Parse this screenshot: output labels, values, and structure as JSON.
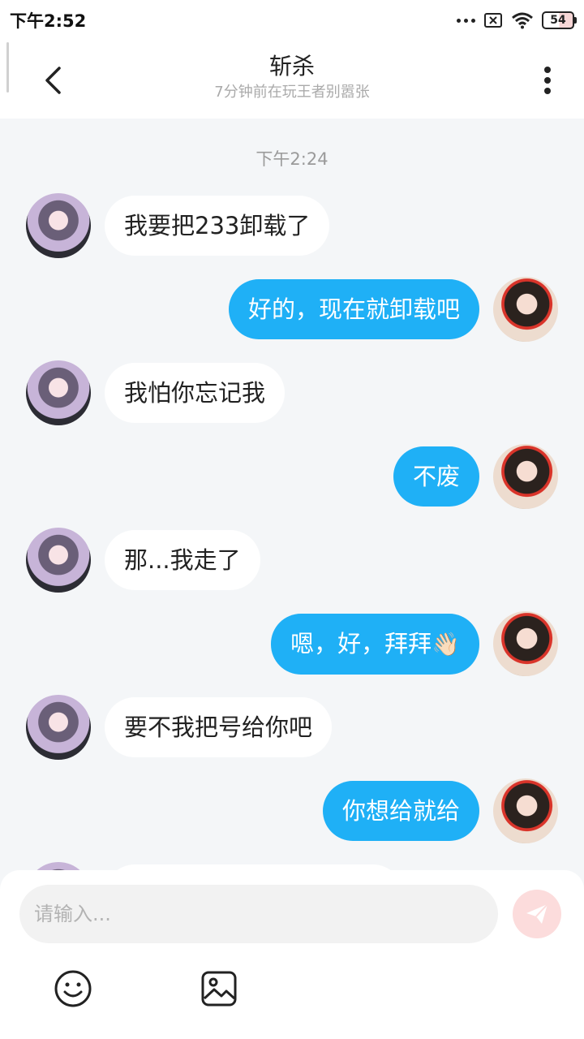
{
  "status_bar": {
    "time": "下午2:52",
    "battery": "54"
  },
  "header": {
    "title": "斩杀",
    "subtitle": "7分钟前在玩王者别嚣张"
  },
  "chat": {
    "timestamp": "下午2:24",
    "messages": [
      {
        "from": "other",
        "text": "我要把233卸载了"
      },
      {
        "from": "me",
        "text": "好的，现在就卸载吧"
      },
      {
        "from": "other",
        "text": "我怕你忘记我"
      },
      {
        "from": "me",
        "text": "不废"
      },
      {
        "from": "other",
        "text": "那...我走了"
      },
      {
        "from": "me",
        "text": "嗯，好，拜拜",
        "emoji": "👋🏻"
      },
      {
        "from": "other",
        "text": "要不我把号给你吧"
      },
      {
        "from": "me",
        "text": "你想给就给"
      }
    ]
  },
  "composer": {
    "placeholder": "请输入..."
  },
  "icons": {
    "back": "back-chevron-icon",
    "more": "more-vertical-icon",
    "send": "send-icon",
    "emoji": "emoji-icon",
    "image": "image-icon"
  },
  "colors": {
    "bubble_out": "#1fb0f6",
    "bubble_in": "#ffffff",
    "background": "#f4f6f8",
    "send_disabled": "#fcdcdc"
  }
}
